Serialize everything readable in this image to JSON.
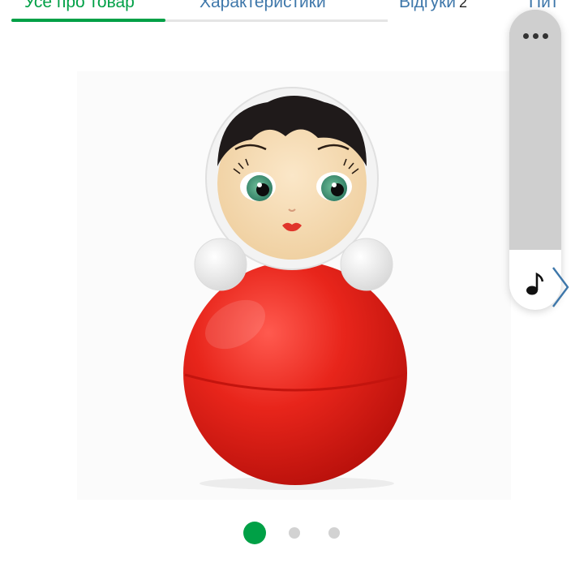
{
  "tabs": [
    {
      "label": "Усе про товар",
      "active": true
    },
    {
      "label": "Характеристики",
      "active": false
    },
    {
      "label": "Відгуки",
      "count": "2",
      "active": false
    },
    {
      "label": "Пит",
      "active": false
    }
  ],
  "gallery": {
    "slide_count": 3,
    "active_slide": 1
  },
  "side_panel": {
    "more_icon": "more-horizontal-icon",
    "music_icon": "music-note-icon"
  },
  "colors": {
    "accent": "#00a046",
    "link": "#3e77aa",
    "doll_red": "#e5201a"
  }
}
